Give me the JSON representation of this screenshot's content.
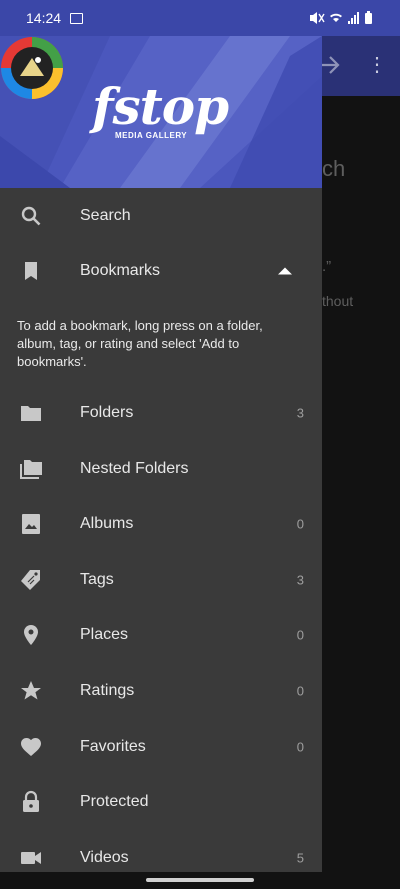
{
  "status_bar": {
    "time": "14:24"
  },
  "background": {
    "text_fragment_1": "ch",
    "text_fragment_2": ".”",
    "text_fragment_3": "thout"
  },
  "drawer": {
    "logo": {
      "name": "fstop",
      "subtitle": "MEDIA GALLERY"
    },
    "items": [
      {
        "label": "Search",
        "icon": "search-icon",
        "count": ""
      },
      {
        "label": "Bookmarks",
        "icon": "bookmark-icon",
        "count": ""
      },
      {
        "label": "Folders",
        "icon": "folder-icon",
        "count": "3"
      },
      {
        "label": "Nested Folders",
        "icon": "nested-folder-icon",
        "count": ""
      },
      {
        "label": "Albums",
        "icon": "album-icon",
        "count": "0"
      },
      {
        "label": "Tags",
        "icon": "tag-icon",
        "count": "3"
      },
      {
        "label": "Places",
        "icon": "place-icon",
        "count": "0"
      },
      {
        "label": "Ratings",
        "icon": "star-icon",
        "count": "0"
      },
      {
        "label": "Favorites",
        "icon": "heart-icon",
        "count": "0"
      },
      {
        "label": "Protected",
        "icon": "lock-icon",
        "count": ""
      },
      {
        "label": "Videos",
        "icon": "video-icon",
        "count": "5"
      }
    ],
    "bookmark_hint": "To add a bookmark, long press on a folder, album, tag, or rating and select 'Add to bookmarks'."
  },
  "colors": {
    "accent": "#4b57bd",
    "drawer_bg": "#3a3a3a",
    "status_bar": "#3b47a8"
  }
}
